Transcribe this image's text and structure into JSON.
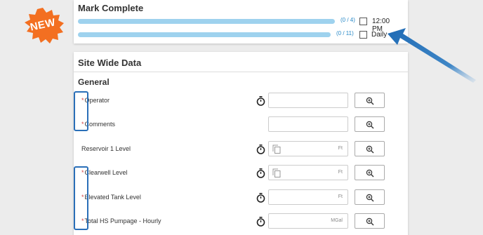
{
  "badge": {
    "label": "NEW",
    "color": "#f36f21"
  },
  "mark_complete": {
    "title": "Mark Complete",
    "rows": [
      {
        "count": "(0 / 4)",
        "schedule": "12:00 PM",
        "progress": 0
      },
      {
        "count": "(0 / 11)",
        "schedule": "Daily",
        "progress": 0
      }
    ]
  },
  "site_wide": {
    "title": "Site Wide Data",
    "section": "General",
    "required_mark": "*",
    "fields": [
      {
        "label": "Operator",
        "required": true,
        "timer": true,
        "copy": false,
        "unit": ""
      },
      {
        "label": "Comments",
        "required": true,
        "timer": false,
        "copy": false,
        "unit": ""
      },
      {
        "label": "Reservoir 1 Level",
        "required": false,
        "timer": true,
        "copy": true,
        "unit": "Ft"
      },
      {
        "label": "Clearwell Level",
        "required": true,
        "timer": true,
        "copy": true,
        "unit": "Ft"
      },
      {
        "label": "Elevated Tank Level",
        "required": true,
        "timer": true,
        "copy": false,
        "unit": "Ft"
      },
      {
        "label": "Total HS Pumpage - Hourly",
        "required": true,
        "timer": true,
        "copy": false,
        "unit": "MGal"
      }
    ]
  },
  "icons": {
    "timer": "stopwatch-icon",
    "copy": "copy-icon",
    "zoom": "zoom-in-icon",
    "checkbox": "checkbox-icon"
  },
  "colors": {
    "progress": "#9ed2ee",
    "count": "#2a8ac8",
    "required": "#d64545",
    "highlight": "#2a6fb8",
    "arrow": "#2a6fb8"
  }
}
